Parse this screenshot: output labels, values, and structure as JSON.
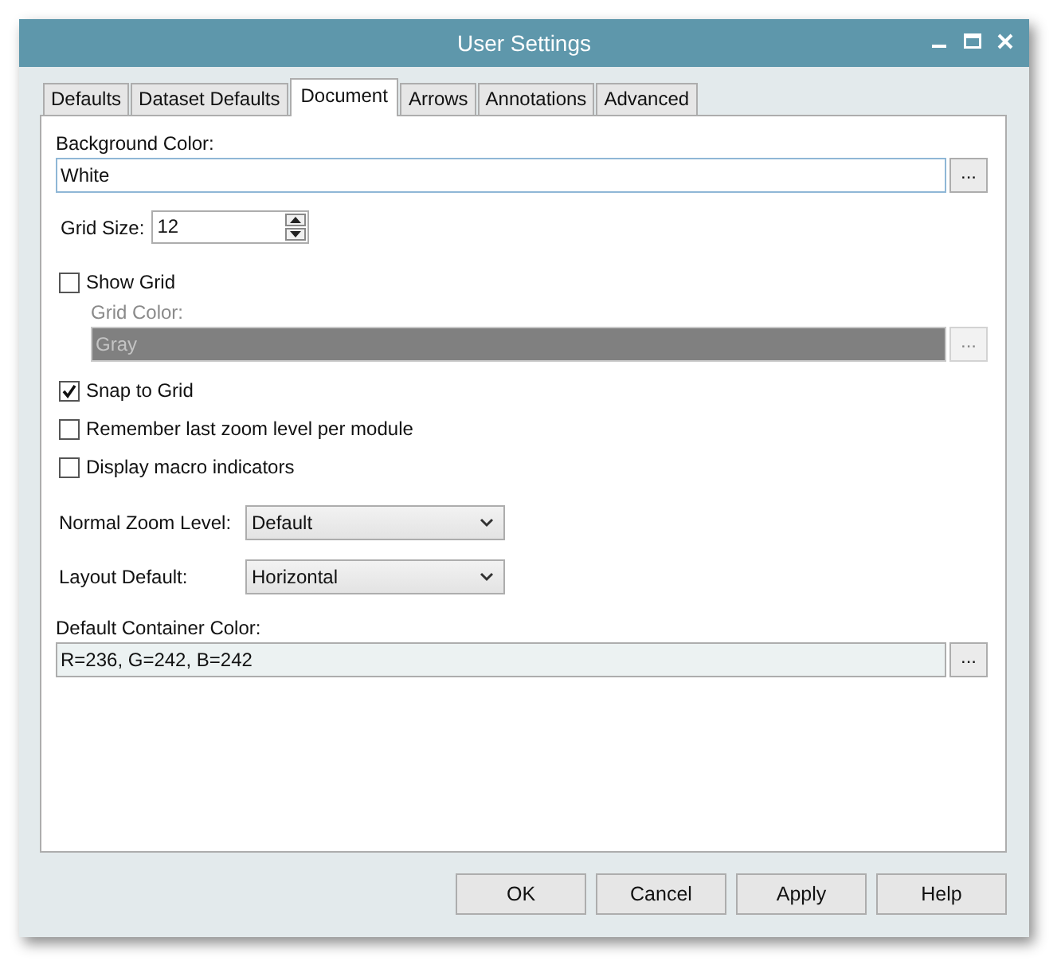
{
  "window": {
    "title": "User Settings"
  },
  "tabs": [
    {
      "label": "Defaults",
      "selected": false
    },
    {
      "label": "Dataset Defaults",
      "selected": false
    },
    {
      "label": "Document",
      "selected": true
    },
    {
      "label": "Arrows",
      "selected": false
    },
    {
      "label": "Annotations",
      "selected": false
    },
    {
      "label": "Advanced",
      "selected": false
    }
  ],
  "settings": [
    {
      "kind": "color",
      "label": "Background Color:",
      "value": "White",
      "disabled": false,
      "button": "..."
    },
    {
      "kind": "spin",
      "label": "Grid Size:",
      "value": "12"
    },
    {
      "kind": "check",
      "label": "Show Grid",
      "checked": false,
      "children": [
        {
          "kind": "color",
          "label": "Grid Color:",
          "value": "Gray",
          "disabled": true,
          "button": "..."
        }
      ]
    },
    {
      "kind": "check",
      "label": "Snap to Grid",
      "checked": true
    },
    {
      "kind": "check",
      "label": "Remember last zoom level per module",
      "checked": false
    },
    {
      "kind": "check",
      "label": "Display macro indicators",
      "checked": false
    },
    {
      "kind": "combo",
      "label": "Normal Zoom Level:",
      "value": "Default"
    },
    {
      "kind": "combo",
      "label": "Layout Default:",
      "value": "Horizontal"
    },
    {
      "kind": "color",
      "label": "Default Container Color:",
      "value": "R=236, G=242, B=242",
      "disabled": false,
      "tinted": true,
      "button": "..."
    }
  ],
  "buttons": [
    "OK",
    "Cancel",
    "Apply",
    "Help"
  ]
}
